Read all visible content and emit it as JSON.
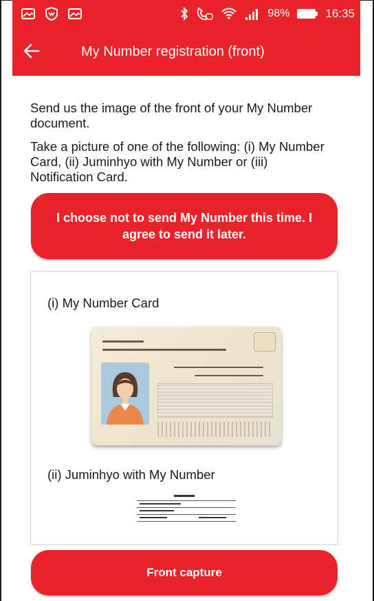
{
  "status_bar": {
    "battery": "98%",
    "time": "16:35",
    "icons_left": [
      "image-icon",
      "shield-icon",
      "image-icon"
    ],
    "icons_right": [
      "bluetooth-icon",
      "call-icon",
      "wifi-icon",
      "signal-icon",
      "battery-icon"
    ]
  },
  "app_bar": {
    "title": "My Number registration (front)",
    "back_icon": "arrow-left-icon"
  },
  "intro": {
    "line1": "Send us the image of the front of your My Number document.",
    "line2": "Take a picture of one of the following: (i) My Number Card, (ii) Juminhyo with My Number or (iii) Notification Card."
  },
  "skip_button": "I choose not to send My Number this time. I agree to send it later.",
  "documents": {
    "card_label": "(i) My Number Card",
    "jumin_label": "(ii) Juminhyo with My Number"
  },
  "capture_button": "Front capture",
  "colors": {
    "accent": "#e8232a",
    "text": "#1a1a1a",
    "panel_border": "#d0d0d0"
  }
}
